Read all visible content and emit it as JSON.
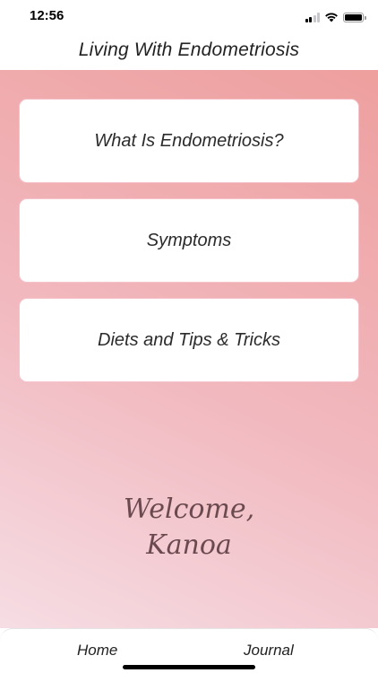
{
  "status_bar": {
    "time": "12:56",
    "icons": [
      "cellular-signal-icon",
      "wifi-icon",
      "battery-icon"
    ]
  },
  "nav": {
    "title": "Living With Endometriosis"
  },
  "menu": {
    "items": [
      {
        "label": "What Is Endometriosis?"
      },
      {
        "label": "Symptoms"
      },
      {
        "label": "Diets and Tips & Tricks"
      }
    ]
  },
  "welcome": {
    "line1": "Welcome,",
    "line2": "Kanoa"
  },
  "tabs": [
    {
      "label": "Home"
    },
    {
      "label": "Journal"
    }
  ],
  "colors": {
    "gradient_light": "#f6dde4",
    "gradient_mid": "#f1b9bf",
    "gradient_dark": "#ee9f9e",
    "card_border": "#f6c3cb",
    "welcome_text": "#6b4a4f"
  }
}
